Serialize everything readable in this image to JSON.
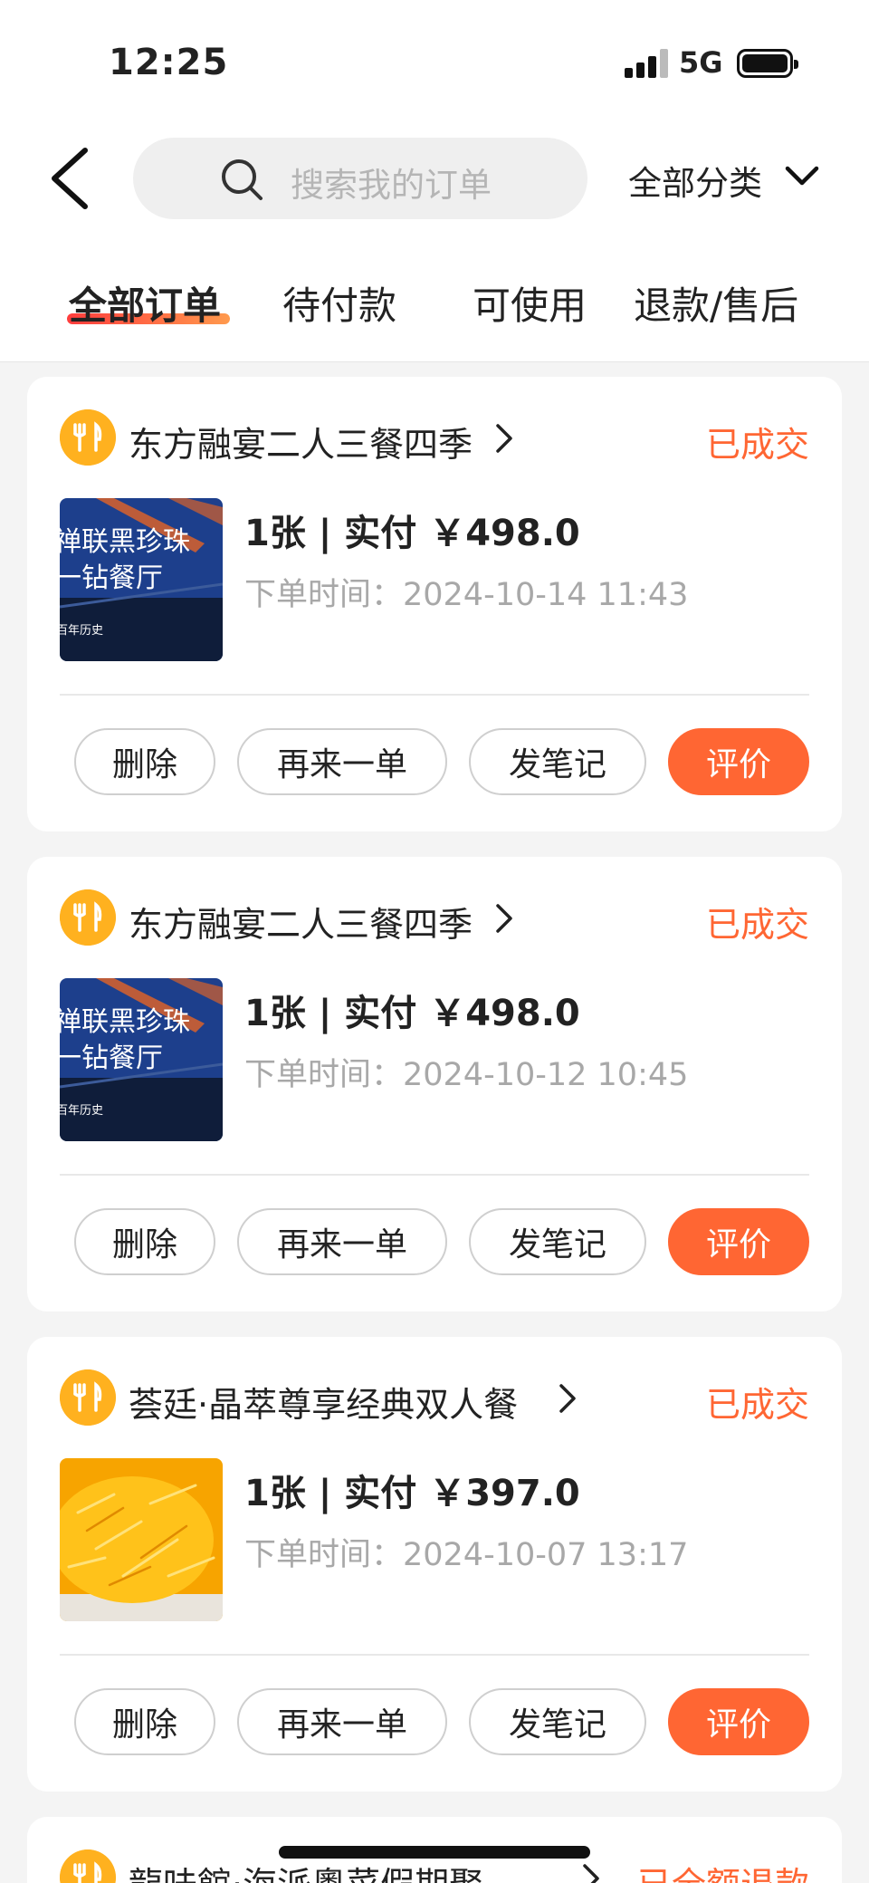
{
  "status_bar": {
    "time": "12:25",
    "network": "5G"
  },
  "header": {
    "search_placeholder": "搜索我的订单",
    "category_label": "全部分类"
  },
  "tabs": [
    {
      "label": "全部订单",
      "active": true
    },
    {
      "label": "待付款",
      "active": false
    },
    {
      "label": "可使用",
      "active": false
    },
    {
      "label": "退款/售后",
      "active": false
    }
  ],
  "orders": [
    {
      "shop": "东方融宴二人三餐四季",
      "status": "已成交",
      "price_line": "1张 | 实付 ￥498.0",
      "order_time": "下单时间：2024-10-14 11:43",
      "thumb_text": [
        "禅联黑珍珠",
        "一钻餐厅",
        "百年历史"
      ],
      "buttons": {
        "delete": "删除",
        "reorder": "再来一单",
        "note": "发笔记",
        "review": "评价"
      }
    },
    {
      "shop": "东方融宴二人三餐四季",
      "status": "已成交",
      "price_line": "1张 | 实付 ￥498.0",
      "order_time": "下单时间：2024-10-12 10:45",
      "thumb_text": [
        "禅联黑珍珠",
        "一钻餐厅",
        "百年历史"
      ],
      "buttons": {
        "delete": "删除",
        "reorder": "再来一单",
        "note": "发笔记",
        "review": "评价"
      }
    },
    {
      "shop": "荟廷·晶萃尊享经典双人餐",
      "status": "已成交",
      "price_line": "1张 | 实付 ￥397.0",
      "order_time": "下单时间：2024-10-07 13:17",
      "buttons": {
        "delete": "删除",
        "reorder": "再来一单",
        "note": "发笔记",
        "review": "评价"
      }
    },
    {
      "shop": "龍味館·海派粵菜假期聚",
      "status": "已全额退款"
    }
  ],
  "colors": {
    "accent": "#ff6633",
    "shop_icon": "#ffb11f"
  }
}
